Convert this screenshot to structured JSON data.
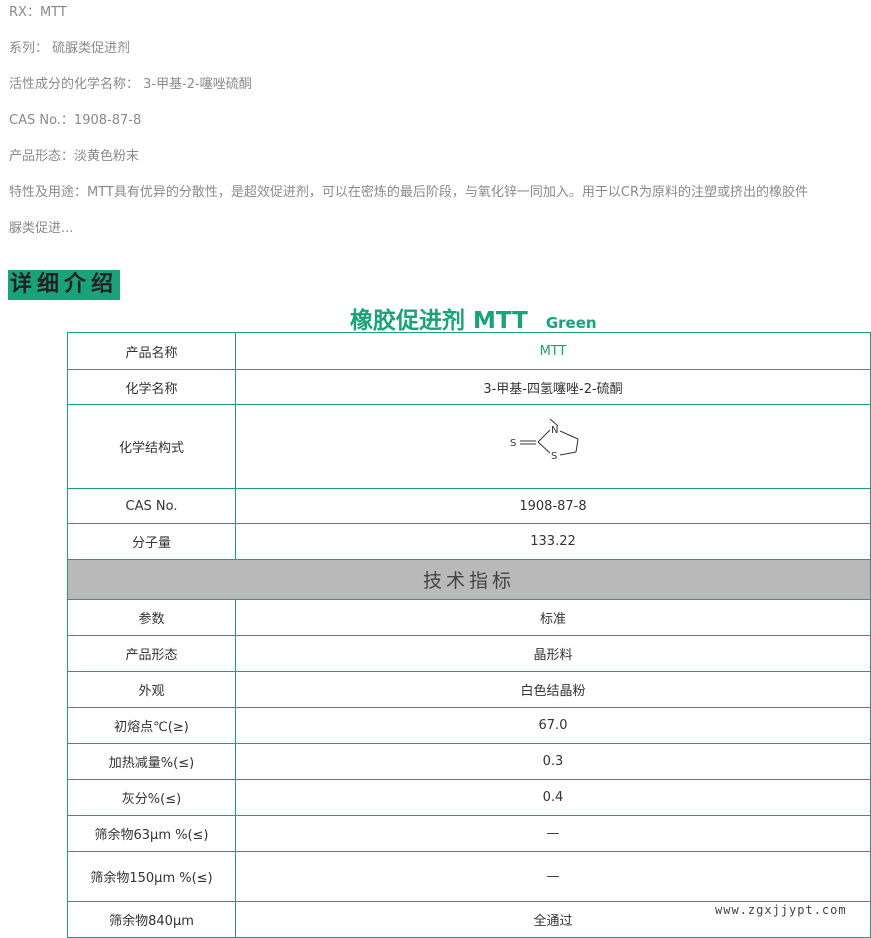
{
  "summary": {
    "rx": "RX：MTT",
    "series": "系列： 硫脲类促进剂",
    "chemical_name": "活性成分的化学名称： 3-甲基-2-噻唑硫酮",
    "cas": "CAS No.：1908-87-8",
    "form": "产品形态：淡黄色粉末",
    "usage_line1": "特性及用途：MTT具有优异的分散性，是超效促进剂，可以在密炼的最后阶段，与氧化锌一同加入。用于以CR为原料的注塑或挤出的橡胶件",
    "usage_line2": "脲类促进..."
  },
  "section_title": "详细介绍",
  "product_title": {
    "main": "橡胶促进剂 MTT",
    "sub": "Green"
  },
  "table": {
    "basic_rows": [
      {
        "label": "产品名称",
        "value": "MTT"
      },
      {
        "label": "化学名称",
        "value": "3-甲基-四氢噻唑-2-硫酮"
      },
      {
        "label": "化学结构式",
        "structure_atoms": [
          "S",
          "N",
          "S"
        ]
      },
      {
        "label": "CAS  No.",
        "value": "1908-87-8"
      },
      {
        "label": "分子量",
        "value": "133.22"
      }
    ],
    "tech_header": "技术指标",
    "tech_rows": [
      {
        "label": "参数",
        "value": "标准"
      },
      {
        "label": "产品形态",
        "value": "晶形料"
      },
      {
        "label": "外观",
        "value": "白色结晶粉"
      },
      {
        "label": "初熔点℃(≥)",
        "value": "67.0"
      },
      {
        "label": "加热减量%(≤)",
        "value": "0.3"
      },
      {
        "label": "灰分%(≤)",
        "value": "0.4"
      },
      {
        "label": "筛余物63μm %(≤)",
        "value": "—"
      },
      {
        "label": "筛余物150μm %(≤)",
        "value": "—"
      },
      {
        "label": "筛余物840μm",
        "value": "全通过"
      }
    ]
  },
  "watermark": "www.zgxjjypt.com",
  "colors": {
    "accent": "#1aa37a",
    "band": "#b9b9b9",
    "muted_text": "#8a8a8a"
  }
}
